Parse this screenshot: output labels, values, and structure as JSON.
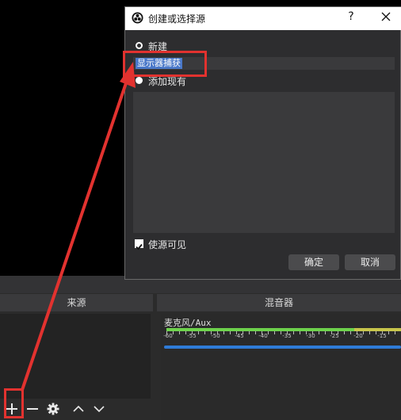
{
  "dialog": {
    "title": "创建或选择源",
    "help": "?",
    "option_new": "新建",
    "name_value": "显示器捕获",
    "option_existing": "添加现有",
    "make_visible": "使源可见",
    "make_visible_checked": true,
    "ok_label": "确定",
    "cancel_label": "取消",
    "selected_option": "new"
  },
  "sources": {
    "header": "来源",
    "toolbar": [
      "add-icon",
      "remove-icon",
      "gear-icon",
      "chevron-up-icon",
      "chevron-down-icon"
    ]
  },
  "mixer": {
    "header": "混音器",
    "channel": "麦克风/Aux",
    "scale": [
      "-60",
      "-55",
      "-50",
      "-45",
      "-40",
      "-35",
      "-30",
      "-25",
      "-20",
      "-15"
    ]
  },
  "annotation_color": "#e2322f"
}
